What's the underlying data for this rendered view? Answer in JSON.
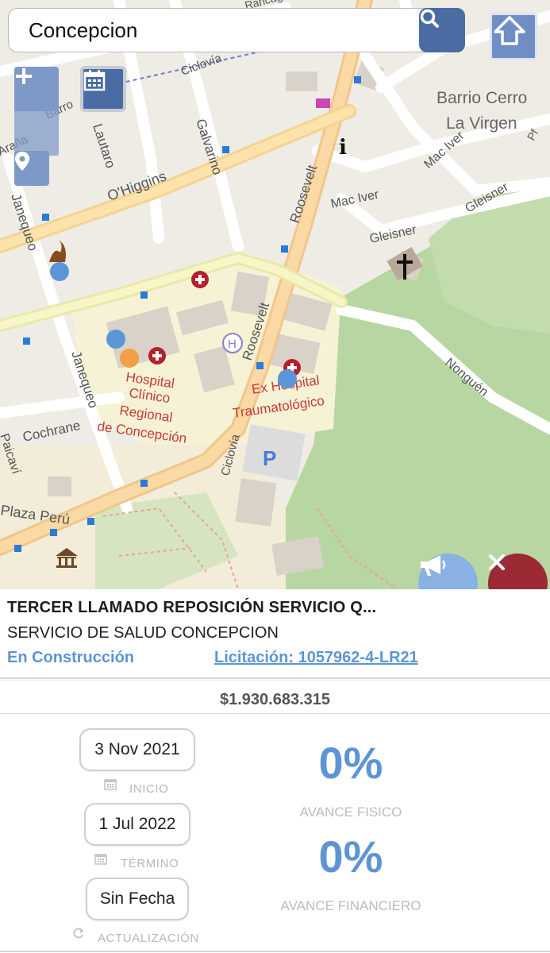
{
  "search": {
    "value": "Concepcion",
    "placeholder": ""
  },
  "map": {
    "streets": [
      "Barrio Cerro",
      "La Virgen",
      "Mac Iver",
      "Mac Iver",
      "Gleisner",
      "Gleisner",
      "Roosevelt",
      "Roosevelt",
      "O'Higgins",
      "Galvarino",
      "Lautaro",
      "Janequeo",
      "Janequeo",
      "Cochrane",
      "Nonguén",
      "Ciclovía",
      "Ciclovía",
      "Barro",
      "Araña",
      "Rancagua",
      "Plaza Perú",
      "Paicaví",
      "Pf"
    ],
    "pois": {
      "hospital_regional": [
        "Hospital",
        "Clínico",
        "Regional",
        "de Concepción"
      ],
      "ex_hospital": [
        "Ex Hospital",
        "Traumatológico"
      ]
    }
  },
  "colors": {
    "accent": "#5d95d4",
    "primary_btn": "#4a6ca3",
    "close_btn": "#9c2a35",
    "marker_blue": "#5b97d8",
    "marker_orange": "#f0a046"
  },
  "project": {
    "title": "TERCER LLAMADO REPOSICIÓN SERVICIO Q...",
    "institution": "SERVICIO DE SALUD CONCEPCION",
    "status": "En Construcción",
    "licitacion": "Licitación: 1057962-4-LR21",
    "amount": "$1.930.683.315"
  },
  "dates": {
    "start": {
      "value": "3 Nov 2021",
      "label": "INICIO"
    },
    "end": {
      "value": "1 Jul 2022",
      "label": "TÉRMINO"
    },
    "update": {
      "value": "Sin Fecha",
      "label": "ACTUALIZACIÓN"
    }
  },
  "progress": {
    "physical": {
      "value": "0%",
      "label": "AVANCE FISICO"
    },
    "financial": {
      "value": "0%",
      "label": "AVANCE FINANCIERO"
    }
  },
  "icons": [
    "search-icon",
    "home-icon",
    "plus-icon",
    "minus-icon",
    "location-pin-icon",
    "calendar-icon",
    "megaphone-icon",
    "close-icon",
    "refresh-icon"
  ]
}
